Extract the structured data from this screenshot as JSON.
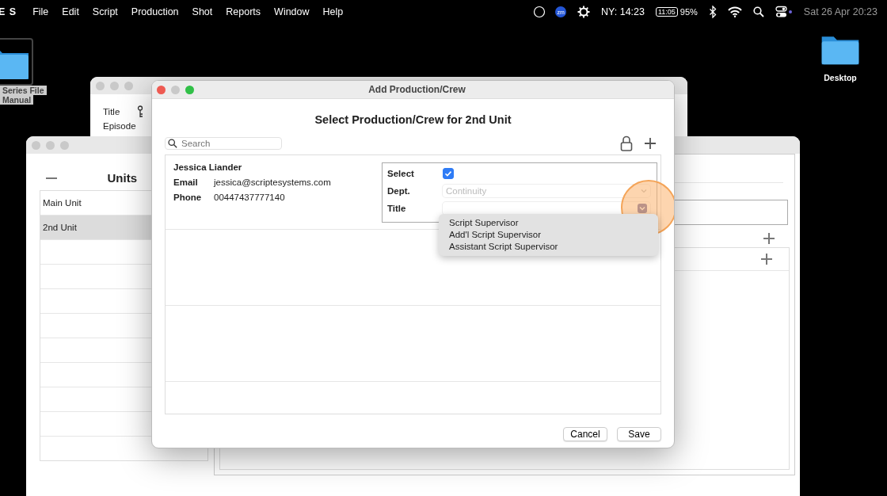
{
  "menu_bar": {
    "app_name": "E S",
    "menus": [
      "File",
      "Edit",
      "Script",
      "Production",
      "Shot",
      "Reports",
      "Window",
      "Help"
    ],
    "status": {
      "app_badge": "zm",
      "clock": "NY: 14:23",
      "battery_time": "11:05",
      "battery_percent": "95%",
      "datetime": "Sat 26 Apr  20:23"
    }
  },
  "desktop_icons": [
    {
      "label_lines": [
        "Series File",
        "Manual"
      ]
    },
    {
      "label_lines": [
        "Desktop"
      ]
    }
  ],
  "back_window": {
    "fields": [
      "Title",
      "Episode"
    ]
  },
  "units_window": {
    "title": "Units",
    "units": [
      {
        "name": "Main Unit",
        "selected": false
      },
      {
        "name": "2nd Unit",
        "selected": true
      }
    ]
  },
  "dialog": {
    "title": "Add Production/Crew",
    "heading": "Select Production/Crew for 2nd Unit",
    "search": {
      "placeholder": "Search"
    },
    "person": {
      "name": "Jessica Liander",
      "details": [
        {
          "label": "Email",
          "value": "jessica@scriptesystems.com"
        },
        {
          "label": "Phone",
          "value": "00447437777140"
        }
      ]
    },
    "select": {
      "label": "Select",
      "checked": true
    },
    "dept": {
      "label": "Dept.",
      "value": "Continuity",
      "disabled": true
    },
    "title_field": {
      "label": "Title",
      "expanded": true,
      "options": [
        "Script Supervisor",
        "Add'l Script Supervisor",
        "Assistant Script Supervisor"
      ]
    },
    "buttons": [
      "Cancel",
      "Save"
    ]
  }
}
